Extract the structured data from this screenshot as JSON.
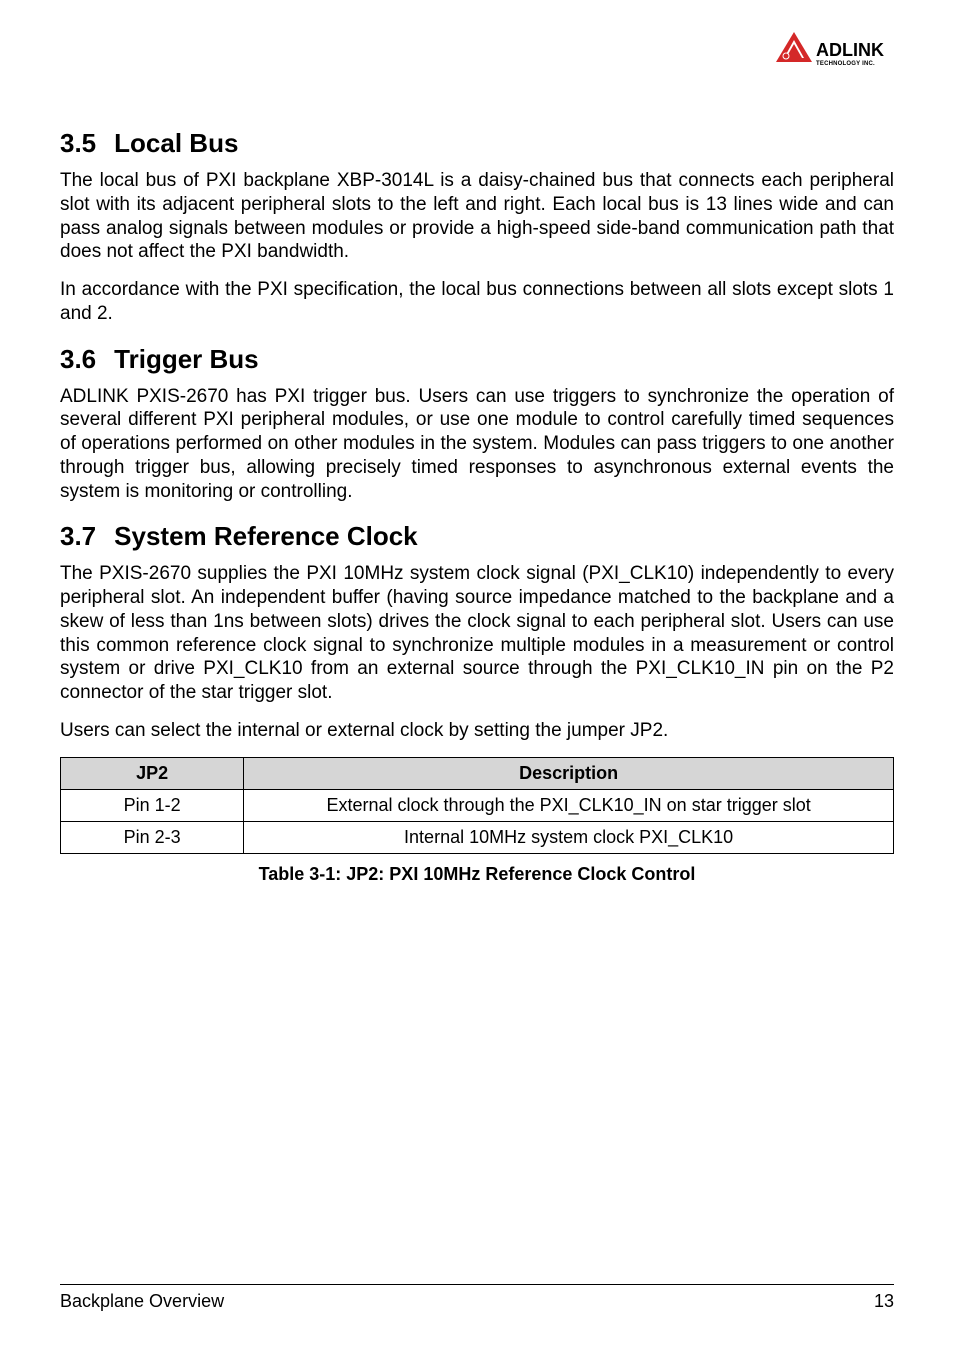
{
  "logo": {
    "brand": "ADLINK",
    "sub": "TECHNOLOGY INC."
  },
  "sections": [
    {
      "num": "3.5",
      "title": "Local Bus",
      "paras": [
        "The local bus of PXI backplane XBP-3014L is a daisy-chained bus that connects each peripheral slot with its adjacent peripheral slots to the left and right. Each local bus is 13 lines wide and can pass analog signals between modules or provide a high-speed side-band communication path that does not affect the PXI bandwidth.",
        "In accordance with the PXI specification, the local bus connections between all slots except slots 1 and 2."
      ]
    },
    {
      "num": "3.6",
      "title": "Trigger Bus",
      "paras": [
        "ADLINK PXIS-2670 has PXI trigger bus. Users can use triggers to synchronize the operation of several different PXI peripheral modules, or use one module to control carefully timed sequences of operations performed on other modules in the system. Modules can pass triggers to one another through trigger bus, allowing precisely timed responses to asynchronous external events the system is monitoring or controlling."
      ]
    },
    {
      "num": "3.7",
      "title": "System Reference Clock",
      "paras": [
        "The PXIS-2670 supplies the PXI 10MHz system clock signal (PXI_CLK10) independently to every peripheral slot. An independent buffer (having source impedance matched to the backplane and a skew of less than 1ns between slots) drives the clock signal to each peripheral slot. Users can use this common reference clock signal to synchronize multiple modules in a measurement or control system or drive PXI_CLK10 from an external source through the PXI_CLK10_IN pin on the P2 connector of the star trigger slot.",
        "Users can select the internal or external clock by setting the jumper JP2."
      ]
    }
  ],
  "table": {
    "headers": [
      "JP2",
      "Description"
    ],
    "rows": [
      [
        "Pin 1-2",
        "External clock through the PXI_CLK10_IN on star trigger slot"
      ],
      [
        "Pin 2-3",
        "Internal 10MHz system clock PXI_CLK10"
      ]
    ],
    "caption": "Table  3-1: JP2: PXI 10MHz Reference Clock Control"
  },
  "footer": {
    "left": "Backplane Overview",
    "right": "13"
  }
}
